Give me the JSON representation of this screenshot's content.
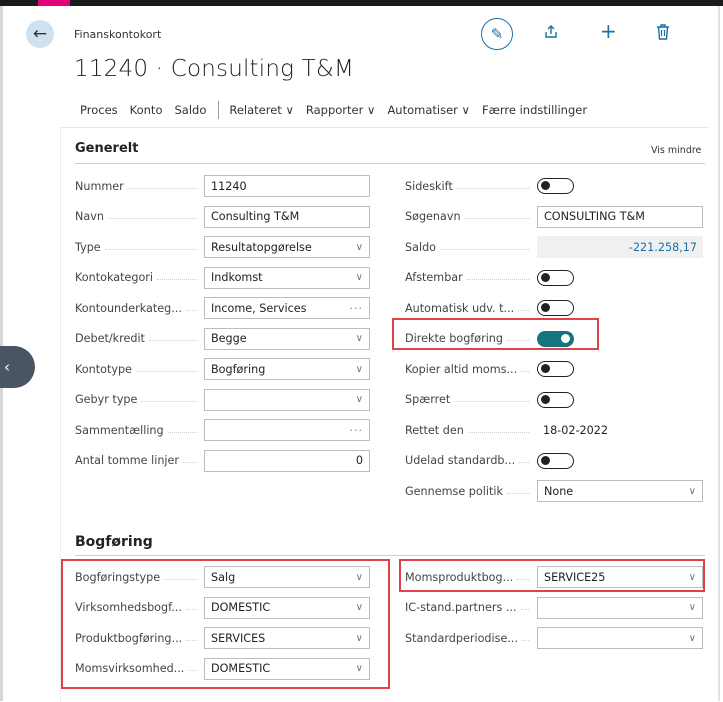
{
  "page": {
    "breadcrumb": "Finanskontokort",
    "title": "11240 · Consulting T&M"
  },
  "actions": {
    "items": [
      "Proces",
      "Konto",
      "Saldo"
    ],
    "menus": [
      "Relateret ∨",
      "Rapporter ∨",
      "Automatiser ∨"
    ],
    "fewer": "Færre indstillinger"
  },
  "generelt": {
    "title": "Generelt",
    "toggle_link": "Vis mindre",
    "left": [
      {
        "label": "Nummer",
        "value": "11240",
        "kind": "text"
      },
      {
        "label": "Navn",
        "value": "Consulting T&M",
        "kind": "text"
      },
      {
        "label": "Type",
        "value": "Resultatopgørelse",
        "kind": "select"
      },
      {
        "label": "Kontokategori",
        "value": "Indkomst",
        "kind": "select"
      },
      {
        "label": "Kontounderkateg...",
        "value": "Income, Services",
        "kind": "lookup"
      },
      {
        "label": "Debet/kredit",
        "value": "Begge",
        "kind": "select"
      },
      {
        "label": "Kontotype",
        "value": "Bogføring",
        "kind": "select"
      },
      {
        "label": "Gebyr type",
        "value": "",
        "kind": "select"
      },
      {
        "label": "Sammentælling",
        "value": "",
        "kind": "lookup"
      },
      {
        "label": "Antal tomme linjer",
        "value": "0",
        "kind": "number"
      }
    ],
    "right": [
      {
        "label": "Sideskift",
        "kind": "toggle",
        "on": false
      },
      {
        "label": "Søgenavn",
        "value": "CONSULTING T&M",
        "kind": "text"
      },
      {
        "label": "Saldo",
        "value": "-221.258,17",
        "kind": "readonly"
      },
      {
        "label": "Afstembar",
        "kind": "toggle",
        "on": false
      },
      {
        "label": "Automatisk udv. t...",
        "kind": "toggle",
        "on": false
      },
      {
        "label": "Direkte bogføring",
        "kind": "toggle",
        "on": true
      },
      {
        "label": "Kopier altid moms...",
        "kind": "toggle",
        "on": false
      },
      {
        "label": "Spærret",
        "kind": "toggle",
        "on": false
      },
      {
        "label": "Rettet den",
        "value": "18-02-2022",
        "kind": "date"
      },
      {
        "label": "Udelad standardb...",
        "kind": "toggle",
        "on": false
      },
      {
        "label": "Gennemse politik",
        "value": "None",
        "kind": "select"
      }
    ]
  },
  "bogforing": {
    "title": "Bogføring",
    "left": [
      {
        "label": "Bogføringstype",
        "value": "Salg"
      },
      {
        "label": "Virksomhedsbogf...",
        "value": "DOMESTIC"
      },
      {
        "label": "Produktbogføring...",
        "value": "SERVICES"
      },
      {
        "label": "Momsvirksomhed...",
        "value": "DOMESTIC"
      }
    ],
    "right": [
      {
        "label": "Momsproduktbog...",
        "value": "SERVICE25"
      },
      {
        "label": "IC-stand.partners ...",
        "value": ""
      },
      {
        "label": "Standardperiodise...",
        "value": ""
      }
    ]
  },
  "icons": {
    "back": "back-arrow-icon",
    "edit": "pencil-icon",
    "share": "share-icon",
    "new": "plus-icon",
    "delete": "trash-icon",
    "collapse": "chevron-left-icon"
  },
  "colors": {
    "accent": "#1b6fa8",
    "toggle_on": "#14757e",
    "highlight": "#e0424a",
    "brand": "#e3007b"
  }
}
